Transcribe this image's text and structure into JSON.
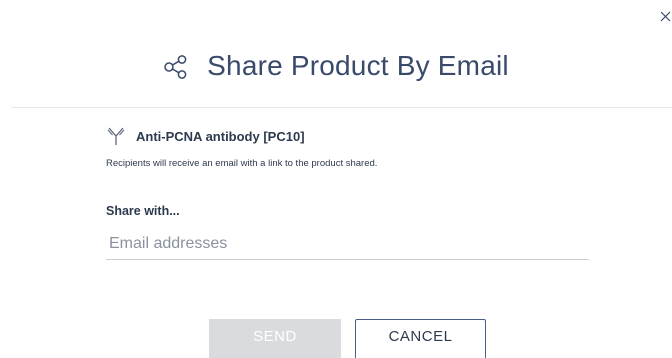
{
  "dialog": {
    "title": "Share Product By Email",
    "title_icon": "share-icon",
    "close_icon": "close-icon"
  },
  "product": {
    "icon": "antibody-icon",
    "name": "Anti-PCNA antibody [PC10]"
  },
  "note": "Recipients will receive an email with a link to the product shared.",
  "share": {
    "label": "Share with...",
    "placeholder": "Email addresses",
    "value": ""
  },
  "actions": {
    "send_label": "SEND",
    "cancel_label": "CANCEL"
  },
  "colors": {
    "title_text": "#3a4a6b",
    "body_text": "#2d3a4d",
    "send_disabled_bg": "#d9dbdf",
    "cancel_border": "#4a5f86",
    "divider": "#e6e8ec"
  }
}
